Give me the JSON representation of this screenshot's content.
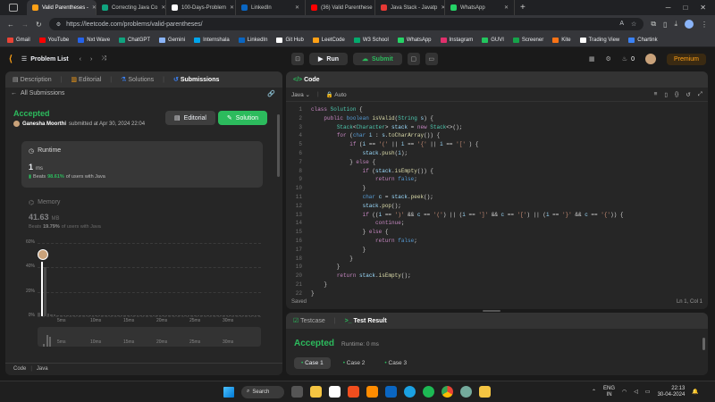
{
  "tabs": [
    {
      "label": "Valid Parentheses - ",
      "color": "#ffa116"
    },
    {
      "label": "Correcting Java Co",
      "color": "#10a37f"
    },
    {
      "label": "100-Days-Problem",
      "color": "#ffffff"
    },
    {
      "label": "LinkedIn",
      "color": "#0a66c2"
    },
    {
      "label": "(36) Valid Parenthese",
      "color": "#ff0000"
    },
    {
      "label": "Java Stack - Javatp",
      "color": "#e53935"
    },
    {
      "label": "WhatsApp",
      "color": "#25d366"
    }
  ],
  "address": {
    "url": "https://leetcode.com/problems/valid-parentheses/"
  },
  "bookmarks": [
    {
      "label": "Gmail",
      "color": "#ea4335"
    },
    {
      "label": "YouTube",
      "color": "#ff0000"
    },
    {
      "label": "Nxt Wave",
      "color": "#2563eb"
    },
    {
      "label": "ChatGPT",
      "color": "#10a37f"
    },
    {
      "label": "Gemini",
      "color": "#8ab4f8"
    },
    {
      "label": "Internshala",
      "color": "#00a5ec"
    },
    {
      "label": "LinkedIn",
      "color": "#0a66c2"
    },
    {
      "label": "Git Hub",
      "color": "#ffffff"
    },
    {
      "label": "LeetCode",
      "color": "#ffa116"
    },
    {
      "label": "W3 School",
      "color": "#04aa6d"
    },
    {
      "label": "WhatsApp",
      "color": "#25d366"
    },
    {
      "label": "Instagram",
      "color": "#e1306c"
    },
    {
      "label": "GUVI",
      "color": "#22c55e"
    },
    {
      "label": "Screener",
      "color": "#16a34a"
    },
    {
      "label": "Kite",
      "color": "#f97316"
    },
    {
      "label": "Trading View",
      "color": "#ffffff"
    },
    {
      "label": "Chartink",
      "color": "#3b82f6"
    }
  ],
  "lcnav": {
    "problem_list": "Problem List",
    "run": "Run",
    "submit": "Submit",
    "streak": "0",
    "premium": "Premium"
  },
  "left": {
    "tabs": [
      "Description",
      "Editorial",
      "Solutions",
      "Submissions"
    ],
    "back": "All Submissions",
    "status": "Accepted",
    "user": "Ganesha Moorthi",
    "submitted": "submitted at Apr 30, 2024 22:04",
    "editorial_btn": "Editorial",
    "solution_btn": "Solution",
    "runtime_label": "Runtime",
    "runtime_value": "1",
    "runtime_unit": "ms",
    "runtime_beats_prefix": "Beats",
    "runtime_beats": "98.61%",
    "runtime_beats_suffix": "of users with Java",
    "memory_label": "Memory",
    "memory_value": "41.63",
    "memory_unit": "MB",
    "memory_beats_prefix": "Beats",
    "memory_beats": "19.79%",
    "memory_beats_suffix": "of users with Java",
    "footer_code": "Code",
    "footer_lang": "Java"
  },
  "chart_data": {
    "type": "bar",
    "yticks": [
      "60%",
      "40%",
      "20%",
      "0%"
    ],
    "ylim": [
      0,
      60
    ],
    "xticks": [
      "5ms",
      "10ms",
      "15ms",
      "20ms",
      "25ms",
      "30ms"
    ],
    "highlight": {
      "x": "1ms",
      "value": 45
    },
    "values": [
      3,
      45,
      40,
      2,
      1.5,
      1.2,
      1,
      1,
      0.8,
      0.8,
      0.6,
      0.6,
      0.5,
      0.5,
      0.5,
      0.4,
      0.4,
      0.4,
      0.3,
      0.3,
      0.3,
      0.3,
      0.3,
      0.3,
      0.3,
      0.3,
      0.3,
      0.3,
      0.3,
      0.3,
      0.3,
      0.3,
      0.3,
      0.3,
      0.3,
      0.3,
      0.3,
      0.3,
      0.3,
      0.3,
      0.3,
      0.3,
      0.3,
      0.3,
      0.3,
      0.3,
      0.3,
      0.3,
      0.3,
      0.3,
      0.3,
      0.3,
      0.3,
      0.3,
      0.3,
      0.3,
      0.3,
      0.3,
      0.3,
      0.3,
      0.3,
      0.3,
      0.3,
      0.3,
      0.3,
      0.3,
      0.3,
      0.3,
      0.3,
      0.3
    ]
  },
  "code": {
    "header": "Code",
    "lang": "Java",
    "auto": "Auto",
    "saved": "Saved",
    "position": "Ln 1, Col 1",
    "lines": [
      [
        [
          "kw",
          "class "
        ],
        [
          "ty",
          "Solution "
        ],
        [
          "pl",
          "{"
        ]
      ],
      [
        [
          "pl",
          "    "
        ],
        [
          "kw",
          "public "
        ],
        [
          "bl",
          "boolean "
        ],
        [
          "fn",
          "isValid"
        ],
        [
          "pl",
          "("
        ],
        [
          "ty",
          "String "
        ],
        [
          "vr",
          "s"
        ],
        [
          "pl",
          ") {"
        ]
      ],
      [
        [
          "pl",
          "        "
        ],
        [
          "ty",
          "Stack"
        ],
        [
          "pl",
          "<"
        ],
        [
          "ty",
          "Character"
        ],
        [
          "pl",
          "> "
        ],
        [
          "vr",
          "stack "
        ],
        [
          "pl",
          "= "
        ],
        [
          "kw",
          "new "
        ],
        [
          "ty",
          "Stack"
        ],
        [
          "pl",
          "<>();"
        ]
      ],
      [
        [
          "pl",
          "        "
        ],
        [
          "kw",
          "for "
        ],
        [
          "pl",
          "("
        ],
        [
          "bl",
          "char "
        ],
        [
          "vr",
          "i "
        ],
        [
          "pl",
          ": "
        ],
        [
          "vr",
          "s"
        ],
        [
          "pl",
          "."
        ],
        [
          "fn",
          "toCharArray"
        ],
        [
          "pl",
          "()) {"
        ]
      ],
      [
        [
          "pl",
          "            "
        ],
        [
          "kw",
          "if "
        ],
        [
          "pl",
          "("
        ],
        [
          "vr",
          "i "
        ],
        [
          "pl",
          "== "
        ],
        [
          "st",
          "'(' "
        ],
        [
          "pl",
          "|| "
        ],
        [
          "vr",
          "i "
        ],
        [
          "pl",
          "== "
        ],
        [
          "st",
          "'{' "
        ],
        [
          "pl",
          "|| "
        ],
        [
          "vr",
          "i "
        ],
        [
          "pl",
          "== "
        ],
        [
          "st",
          "'[' "
        ],
        [
          "pl",
          ") {"
        ]
      ],
      [
        [
          "pl",
          "                "
        ],
        [
          "vr",
          "stack"
        ],
        [
          "pl",
          "."
        ],
        [
          "fn",
          "push"
        ],
        [
          "pl",
          "("
        ],
        [
          "vr",
          "i"
        ],
        [
          "pl",
          ");"
        ]
      ],
      [
        [
          "pl",
          "            } "
        ],
        [
          "kw",
          "else "
        ],
        [
          "pl",
          "{"
        ]
      ],
      [
        [
          "pl",
          "                "
        ],
        [
          "kw",
          "if "
        ],
        [
          "pl",
          "("
        ],
        [
          "vr",
          "stack"
        ],
        [
          "pl",
          "."
        ],
        [
          "fn",
          "isEmpty"
        ],
        [
          "pl",
          "()) {"
        ]
      ],
      [
        [
          "pl",
          "                    "
        ],
        [
          "kw",
          "return "
        ],
        [
          "bl",
          "false"
        ],
        [
          "pl",
          ";"
        ]
      ],
      [
        [
          "pl",
          "                }"
        ]
      ],
      [
        [
          "pl",
          "                "
        ],
        [
          "bl",
          "char "
        ],
        [
          "vr",
          "c "
        ],
        [
          "pl",
          "= "
        ],
        [
          "vr",
          "stack"
        ],
        [
          "pl",
          "."
        ],
        [
          "fn",
          "peek"
        ],
        [
          "pl",
          "();"
        ]
      ],
      [
        [
          "pl",
          "                "
        ],
        [
          "vr",
          "stack"
        ],
        [
          "pl",
          "."
        ],
        [
          "fn",
          "pop"
        ],
        [
          "pl",
          "();"
        ]
      ],
      [
        [
          "pl",
          "                "
        ],
        [
          "kw",
          "if "
        ],
        [
          "pl",
          "(("
        ],
        [
          "vr",
          "i "
        ],
        [
          "pl",
          "== "
        ],
        [
          "st",
          "')' "
        ],
        [
          "pl",
          "&& "
        ],
        [
          "vr",
          "c "
        ],
        [
          "pl",
          "== "
        ],
        [
          "st",
          "'('"
        ],
        [
          "pl",
          ") || ("
        ],
        [
          "vr",
          "i "
        ],
        [
          "pl",
          "== "
        ],
        [
          "st",
          "']' "
        ],
        [
          "pl",
          "&& "
        ],
        [
          "vr",
          "c "
        ],
        [
          "pl",
          "== "
        ],
        [
          "st",
          "'['"
        ],
        [
          "pl",
          ") || ("
        ],
        [
          "vr",
          "i "
        ],
        [
          "pl",
          "== "
        ],
        [
          "st",
          "'}' "
        ],
        [
          "pl",
          "&& "
        ],
        [
          "vr",
          "c "
        ],
        [
          "pl",
          "== "
        ],
        [
          "st",
          "'{'"
        ],
        [
          "pl",
          ")) {"
        ]
      ],
      [
        [
          "pl",
          "                    "
        ],
        [
          "kw",
          "continue"
        ],
        [
          "pl",
          ";"
        ]
      ],
      [
        [
          "pl",
          "                } "
        ],
        [
          "kw",
          "else "
        ],
        [
          "pl",
          "{"
        ]
      ],
      [
        [
          "pl",
          "                    "
        ],
        [
          "kw",
          "return "
        ],
        [
          "bl",
          "false"
        ],
        [
          "pl",
          ";"
        ]
      ],
      [
        [
          "pl",
          "                }"
        ]
      ],
      [
        [
          "pl",
          "            }"
        ]
      ],
      [
        [
          "pl",
          "        }"
        ]
      ],
      [
        [
          "pl",
          "        "
        ],
        [
          "kw",
          "return "
        ],
        [
          "vr",
          "stack"
        ],
        [
          "pl",
          "."
        ],
        [
          "fn",
          "isEmpty"
        ],
        [
          "pl",
          "();"
        ]
      ],
      [
        [
          "pl",
          "    }"
        ]
      ],
      [
        [
          "pl",
          "}"
        ]
      ]
    ]
  },
  "test": {
    "testcase": "Testcase",
    "result": "Test Result",
    "status": "Accepted",
    "runtime": "Runtime: 0 ms",
    "cases": [
      "Case 1",
      "Case 2",
      "Case 3"
    ]
  },
  "taskbar": {
    "search": "Search",
    "lang1": "ENG",
    "lang2": "IN",
    "time": "22:13",
    "date": "30-04-2024"
  }
}
